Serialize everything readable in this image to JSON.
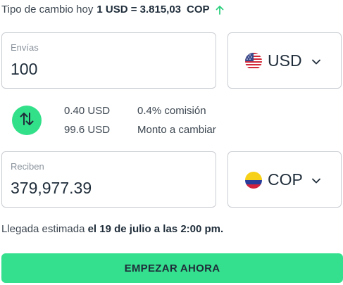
{
  "rate": {
    "prefix": "Tipo de cambio hoy",
    "value": "1 USD = 3.815,03",
    "currency": "COP",
    "trend": "up-arrow-icon"
  },
  "send": {
    "label": "Envías",
    "amount": "100",
    "currency": "USD",
    "flag": "us-flag-icon"
  },
  "fees": {
    "swap_icon": "swap-arrows-icon",
    "rows": [
      {
        "amount": "0.40 USD",
        "description": "0.4% comisión"
      },
      {
        "amount": "99.6 USD",
        "description": "Monto a cambiar"
      }
    ]
  },
  "receive": {
    "label": "Reciben",
    "amount": "379,977.39",
    "currency": "COP",
    "flag": "colombia-flag-icon"
  },
  "eta": {
    "prefix": "Llegada estimada",
    "date": "el 19 de julio a las 2:00 pm."
  },
  "cta": {
    "label": "EMPEZAR AHORA"
  },
  "colors": {
    "accent": "#34e08e",
    "border": "#c9cdd2",
    "text": "#1f2d3a",
    "muted": "#8a939c"
  }
}
